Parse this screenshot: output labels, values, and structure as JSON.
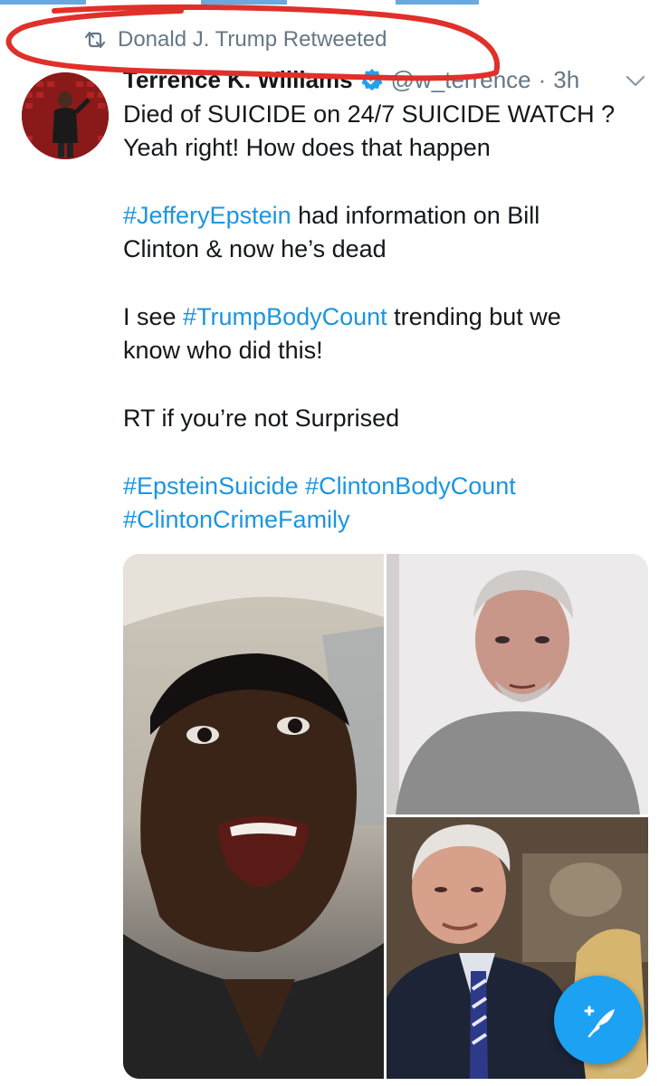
{
  "retweet": {
    "label": "Donald J. Trump Retweeted",
    "icon": "retweet-icon"
  },
  "tweet": {
    "author_name": "Terrence K. Williams",
    "verified": true,
    "handle": "@w_terrence",
    "separator": "·",
    "time": "3h",
    "lines": [
      "Died of SUICIDE on 24/7 SUICIDE WATCH ?",
      "Yeah right! How does that happen"
    ],
    "para2": {
      "hashtag": "#JefferyEpstein",
      "text_a": " had information on Bill",
      "text_b": "Clinton & now he’s dead"
    },
    "para3": {
      "text_a": "I see ",
      "hashtag": "#TrumpBodyCount",
      "text_b": " trending but we",
      "text_c": "know who did this!"
    },
    "para4": "RT if you’re not Surprised",
    "hashtags_line1": [
      "#EpsteinSuicide",
      "#ClintonBodyCount"
    ],
    "hashtags_line2": "#ClintonCrimeFamily"
  },
  "media": {
    "count": 3,
    "descriptions": [
      "man-speaking-in-car-photo",
      "jeffrey-epstein-mugshot-photo",
      "bill-clinton-photo"
    ]
  },
  "icons": {
    "options": "chevron-down-icon",
    "compose": "compose-tweet-icon",
    "verified": "verified-badge-icon"
  },
  "colors": {
    "link": "#1b95e0",
    "secondary": "#657786",
    "fab": "#1da1f2",
    "annotation": "#e0302a"
  }
}
